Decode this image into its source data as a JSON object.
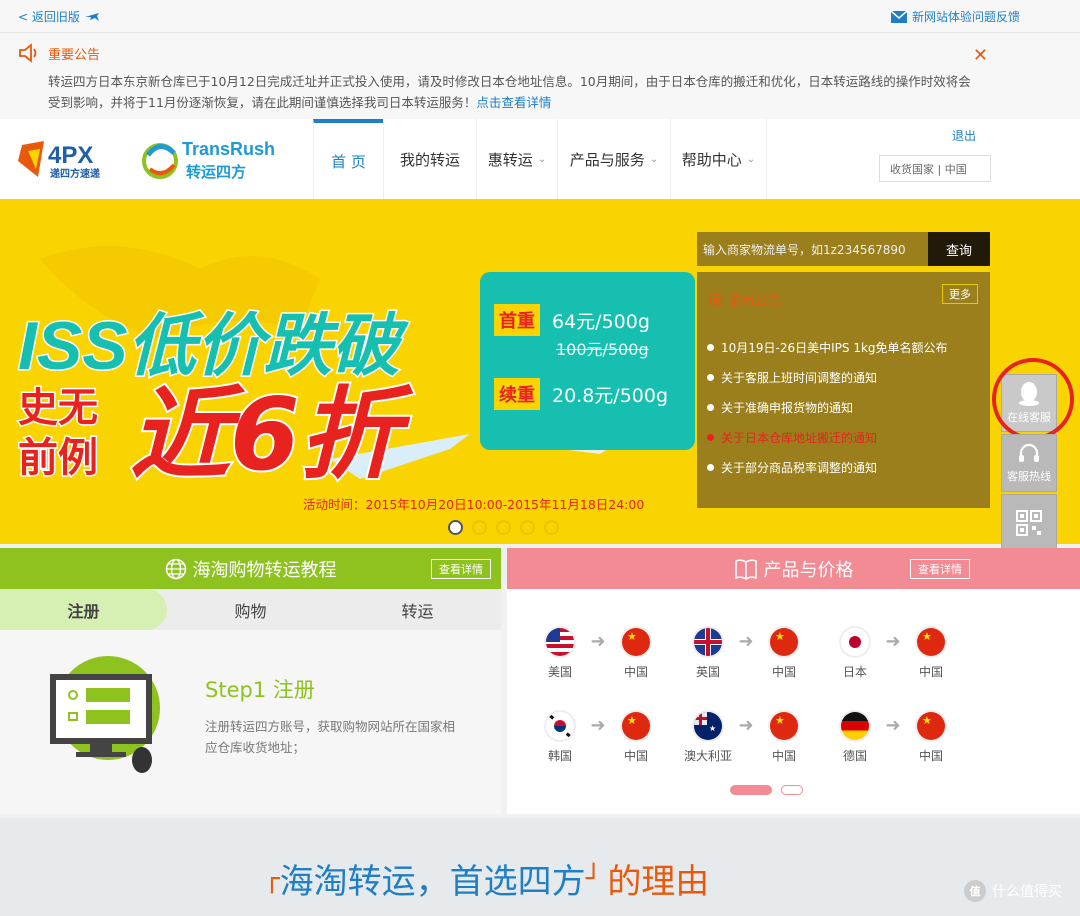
{
  "topbar": {
    "back_label": "< 返回旧版",
    "feedback_label": "新网站体验问题反馈"
  },
  "notice": {
    "title": "重要公告",
    "text": "转运四方日本东京新仓库已于10月12日完成迁址并正式投入使用，请及时修改日本仓地址信息。10月期间，由于日本仓库的搬迁和优化，日本转运路线的操作时效将会受到影响，并将于11月份逐渐恢复，请在此期间谨慎选择我司日本转运服务！",
    "link": "点击查看详情"
  },
  "header": {
    "logo_4px": "4PX",
    "logo_4px_sub": "递四方速递",
    "logo_tr": "TransRush",
    "logo_tr_sub": "转运四方",
    "nav": [
      {
        "label": "首 页"
      },
      {
        "label": "我的转运"
      },
      {
        "label": "惠转运"
      },
      {
        "label": "产品与服务"
      },
      {
        "label": "帮助中心"
      }
    ],
    "logout": "退出",
    "country": "收货国家 | 中国"
  },
  "banner": {
    "headline_1": "ISS低价跌破",
    "headline_2": "近6折",
    "headline_side_1": "史无",
    "headline_side_2": "前例",
    "first_tag": "首重",
    "first_price": "64元/500g",
    "old_price": "100元/500g",
    "cont_tag": "续重",
    "cont_price": "20.8元/500g",
    "activity": "活动时间：2015年10月20日10:00-2015年11月18日24:00",
    "search_placeholder": "输入商家物流单号，如1z234567890",
    "search_btn": "查询",
    "news_title": "最新公告",
    "news_more": "更多",
    "news": [
      "10月19日-26日美中IPS 1kg免单名额公布",
      "关于客服上班时间调整的通知",
      "关于准确申报货物的通知",
      "关于日本仓库地址搬迁的通知",
      "关于部分商品税率调整的通知"
    ]
  },
  "side": {
    "online": "在线客服",
    "hotline": "客服热线"
  },
  "tutorial": {
    "title": "海淘购物转运教程",
    "detail": "查看详情",
    "tabs": [
      "注册",
      "购物",
      "转运"
    ],
    "step": "Step1 注册",
    "desc": "注册转运四方账号，获取购物网站所在国家相应仓库收货地址；"
  },
  "products": {
    "title": "产品与价格",
    "detail": "查看详情",
    "routes": [
      {
        "from": "美国",
        "to": "中国"
      },
      {
        "from": "英国",
        "to": "中国"
      },
      {
        "from": "日本",
        "to": "中国"
      },
      {
        "from": "韩国",
        "to": "中国"
      },
      {
        "from": "澳大利亚",
        "to": "中国"
      },
      {
        "from": "德国",
        "to": "中国"
      }
    ]
  },
  "bottom": {
    "slogan": "海淘转运，首选四方",
    "slogan_rest": "的理由",
    "watermark": "什么值得买",
    "watermark_badge": "值"
  }
}
